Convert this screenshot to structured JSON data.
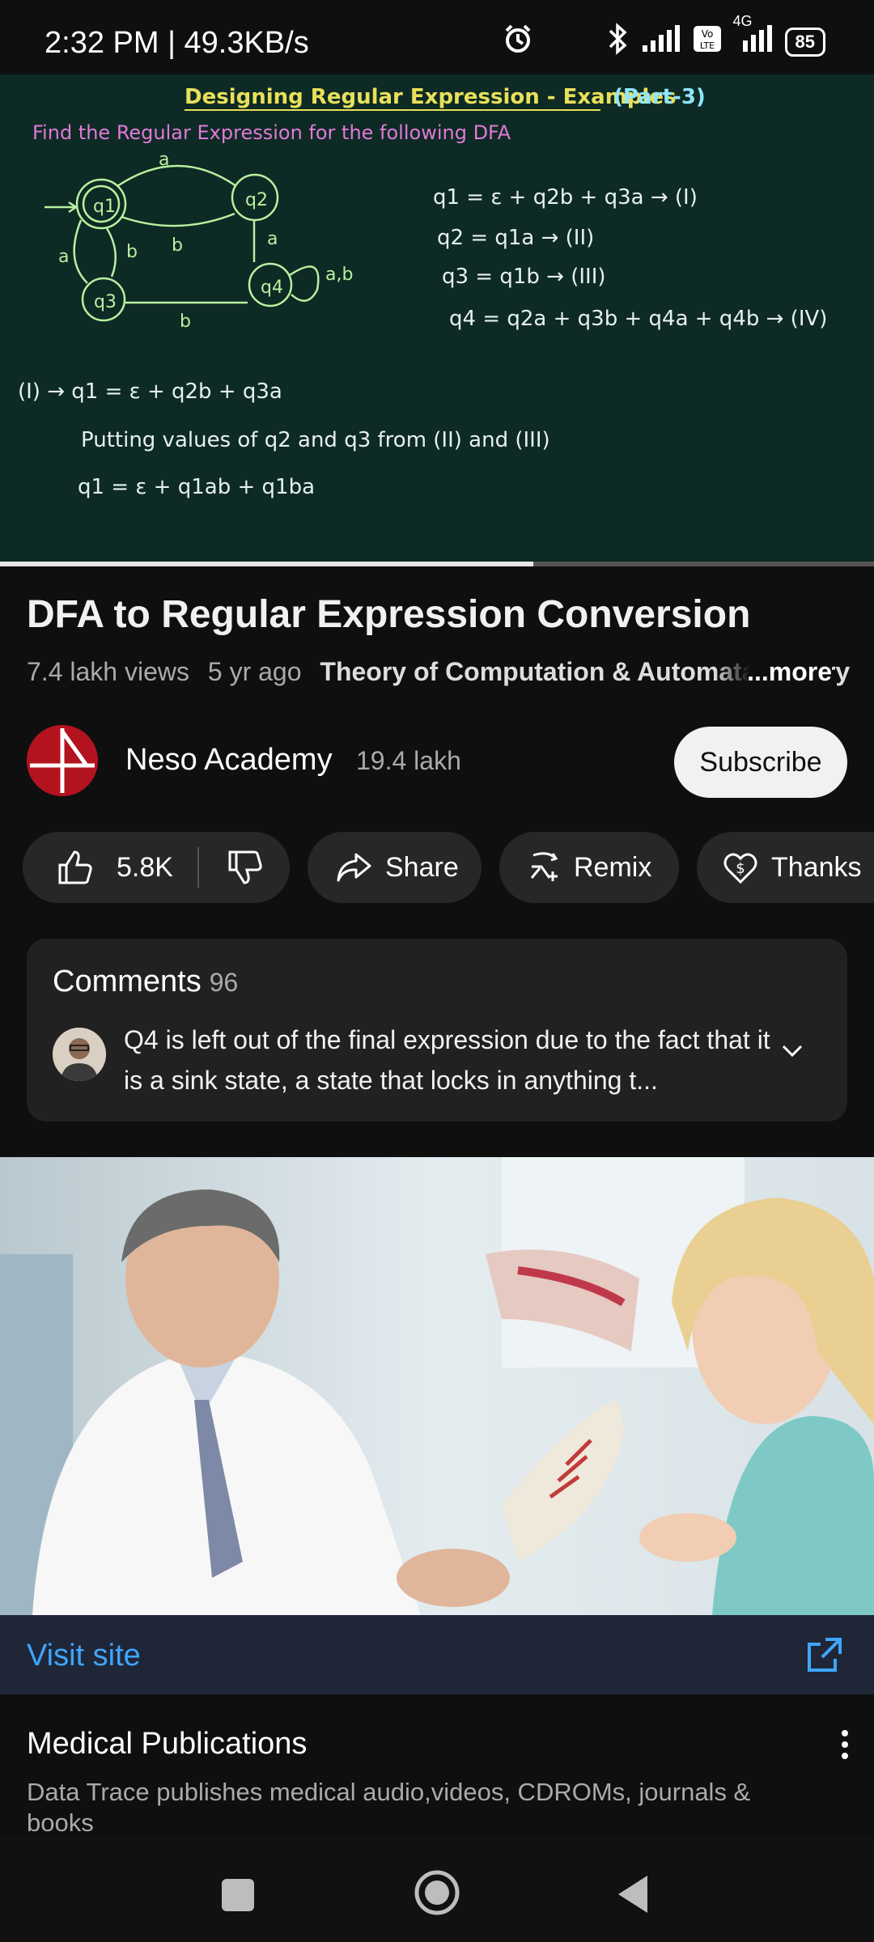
{
  "status": {
    "time": "2:32 PM | 49.3KB/s",
    "network_type": "4G",
    "battery": "85"
  },
  "video": {
    "heading": "Designing Regular Expression - Examples",
    "part": "(Part-3)",
    "task": "Find the Regular Expression for the following DFA",
    "states": [
      "q1",
      "q2",
      "q3",
      "q4"
    ],
    "edge_labels": [
      "a",
      "a",
      "b",
      "b",
      "a",
      "b",
      "a,b"
    ],
    "equations": [
      "q1 = ε + q2b + q3a → (I)",
      "q2 = q1a → (II)",
      "q3 = q1b → (III)",
      "q4 = q2a + q3b + q4a + q4b → (IV)"
    ],
    "work": [
      "(I) → q1 = ε + q2b + q3a",
      "Putting values of q2 and q3 from (II) and (III)",
      "q1 = ε + q1ab + q1ba"
    ],
    "progress": 0.61
  },
  "details": {
    "title": "DFA to Regular Expression Conversion",
    "views": "7.4 lakh views",
    "age": "5 yr ago",
    "playlist": "Theory of Computation & Automata Theory",
    "more": "...more"
  },
  "channel": {
    "name": "Neso Academy",
    "subscribers": "19.4 lakh",
    "subscribe_label": "Subscribe",
    "brand_color": "#b3121f"
  },
  "actions": {
    "likes": "5.8K",
    "share": "Share",
    "remix": "Remix",
    "thanks": "Thanks"
  },
  "comments": {
    "title": "Comments",
    "count": "96",
    "top_comment": "Q4 is left out of the final expression due to the fact that it is a sink state, a state that locks in anything t..."
  },
  "ad": {
    "visit_label": "Visit site",
    "title": "Medical Publications",
    "description": "Data Trace publishes medical audio,videos, CDROMs, journals & books",
    "link_color": "#3ea6ff"
  }
}
